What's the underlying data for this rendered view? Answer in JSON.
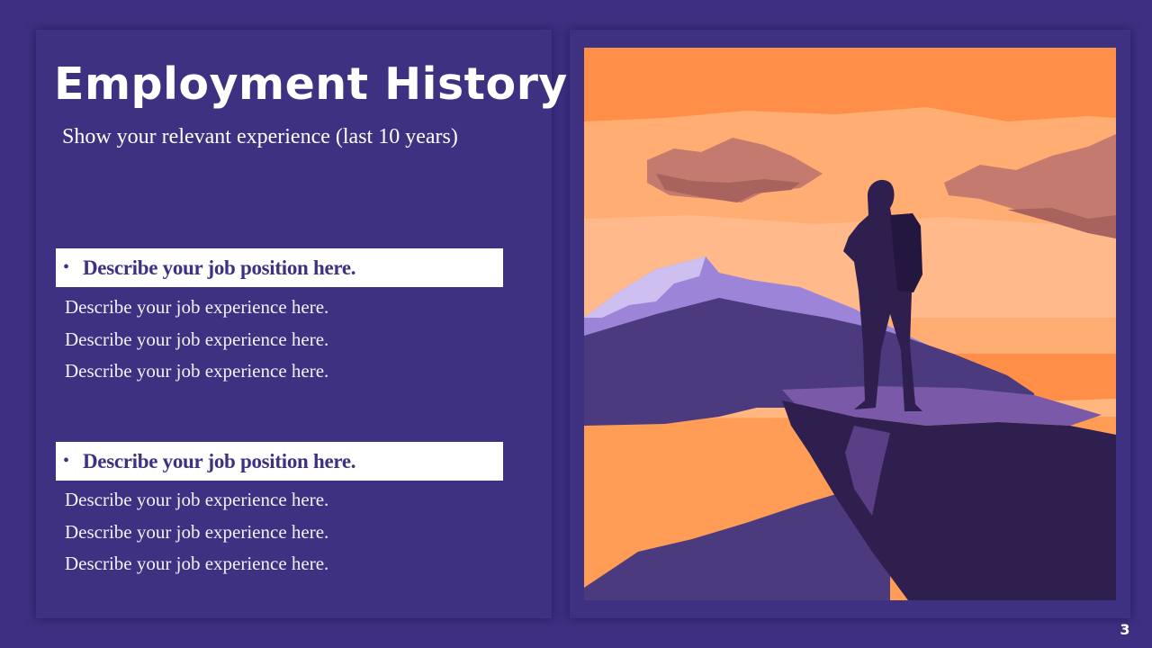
{
  "slide": {
    "title": "Employment History",
    "subtitle": "Show your relevant experience (last 10 years)",
    "page_number": "3"
  },
  "jobs": [
    {
      "bullet": "•",
      "position": "Describe your job position here.",
      "experiences": [
        "Describe your job experience here.",
        "Describe your job experience here.",
        "Describe your job experience here."
      ]
    },
    {
      "bullet": "•",
      "position": "Describe your job position here.",
      "experiences": [
        "Describe your job experience here.",
        "Describe your job experience here.",
        "Describe your job experience here."
      ]
    }
  ],
  "illustration": {
    "icon": "hiker-on-cliff-sunset-illustration",
    "colors": {
      "sky_top": "#ff8f48",
      "sky_band": "#ffad73",
      "lake": "#ff9c56",
      "mountain_light": "#9c84d8",
      "mountain_dark": "#4b3a7e",
      "silhouette": "#2e1f4e",
      "cloud": "#c47a6e"
    }
  },
  "theme": {
    "background": "#3e2f82",
    "panel": "#3e3181",
    "accent_text": "#3e3181",
    "text": "#ffffff"
  }
}
